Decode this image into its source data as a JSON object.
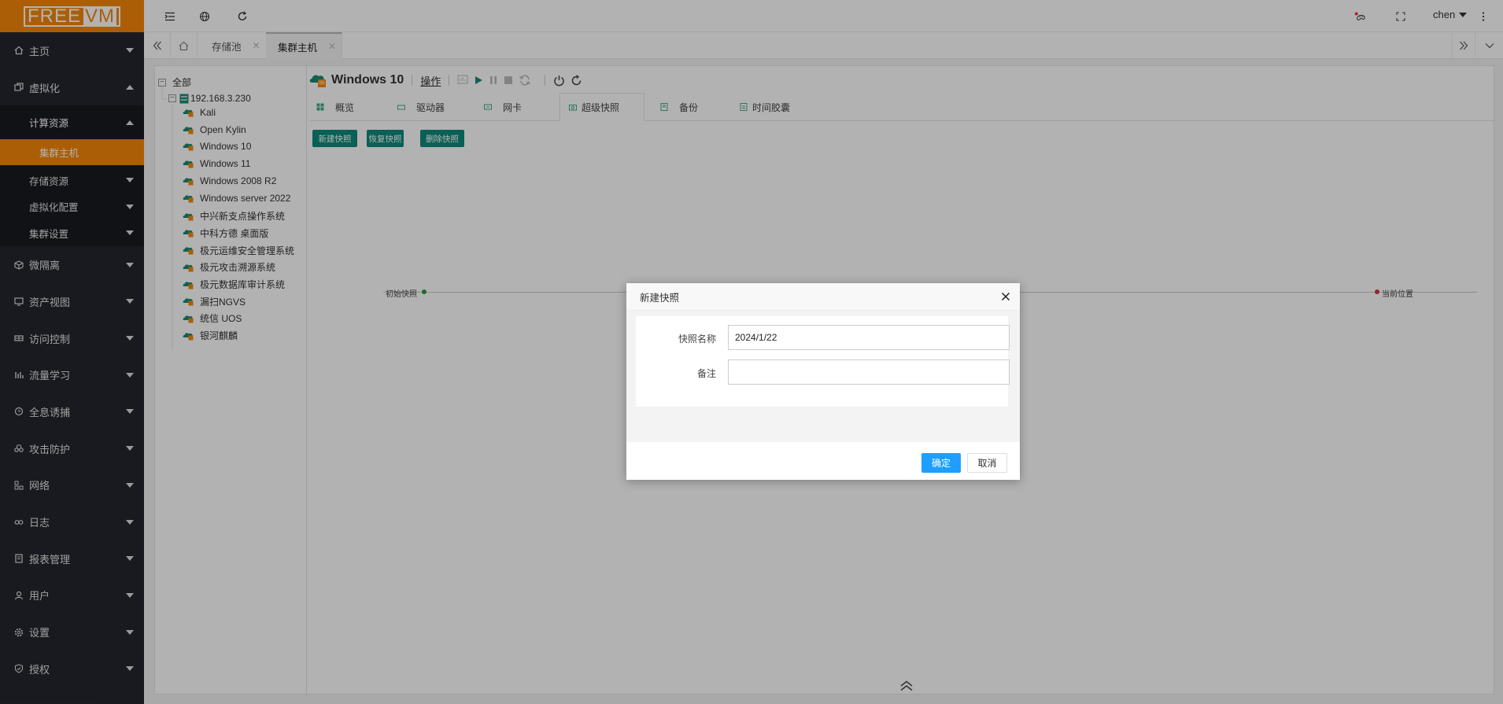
{
  "logo": {
    "text_free": "FREE",
    "text_vm": "VM"
  },
  "sidebar": {
    "items": [
      {
        "label": "主页",
        "icon": "home-icon"
      },
      {
        "label": "虚拟化",
        "icon": "virtualization-icon"
      },
      {
        "label": "微隔离",
        "icon": "cube-icon"
      },
      {
        "label": "资产视图",
        "icon": "monitor-icon"
      },
      {
        "label": "访问控制",
        "icon": "grid-icon"
      },
      {
        "label": "流量学习",
        "icon": "bars-icon"
      },
      {
        "label": "全息诱捕",
        "icon": "capture-icon"
      },
      {
        "label": "攻击防护",
        "icon": "binoculars-icon"
      },
      {
        "label": "网络",
        "icon": "network-icon"
      },
      {
        "label": "日志",
        "icon": "link-icon"
      },
      {
        "label": "报表管理",
        "icon": "report-icon"
      },
      {
        "label": "用户",
        "icon": "user-icon"
      },
      {
        "label": "设置",
        "icon": "gear-icon"
      },
      {
        "label": "授权",
        "icon": "shield-check-icon"
      }
    ],
    "virtualization_sub": {
      "compute": "计算资源",
      "cluster_host": "集群主机",
      "storage": "存储资源",
      "config": "虚拟化配置",
      "cluster_settings": "集群设置"
    }
  },
  "header": {
    "username": "chen"
  },
  "tabs": [
    {
      "label": "存储池"
    },
    {
      "label": "集群主机"
    }
  ],
  "tree": {
    "root": "全部",
    "host": "192.168.3.230",
    "vms": [
      "Kali",
      "Open Kylin",
      "Windows 10",
      "Windows 11",
      "Windows 2008 R2",
      "Windows server 2022",
      "中兴新支点操作系统",
      "中科方德 桌面版",
      "极元运维安全管理系统",
      "极元攻击溯源系统",
      "极元数据库审计系统",
      "漏扫NGVS",
      "统信 UOS",
      "银河麒麟"
    ]
  },
  "vm": {
    "title": "Windows 10",
    "operation_label": "操作"
  },
  "detail_tabs": [
    {
      "label": "概览"
    },
    {
      "label": "驱动器"
    },
    {
      "label": "网卡"
    },
    {
      "label": "超级快照"
    },
    {
      "label": "备份"
    },
    {
      "label": "时间胶囊"
    }
  ],
  "actions": {
    "new_snapshot": "新建快照",
    "restore_snapshot": "恢复快照",
    "delete_snapshot": "删除快照"
  },
  "timeline": {
    "start_label": "初始快照",
    "end_label": "当前位置",
    "start_color": "#2a9d3c",
    "end_color": "#d9363e"
  },
  "dialog": {
    "title": "新建快照",
    "name_label": "快照名称",
    "name_value": "2024/1/22",
    "note_label": "备注",
    "note_value": "",
    "ok_label": "确定",
    "cancel_label": "取消"
  },
  "colors": {
    "brand": "#f5870a",
    "primary_button": "#1e9fff",
    "action_button": "#0e8a7a",
    "sidebar_bg": "#24262e"
  }
}
